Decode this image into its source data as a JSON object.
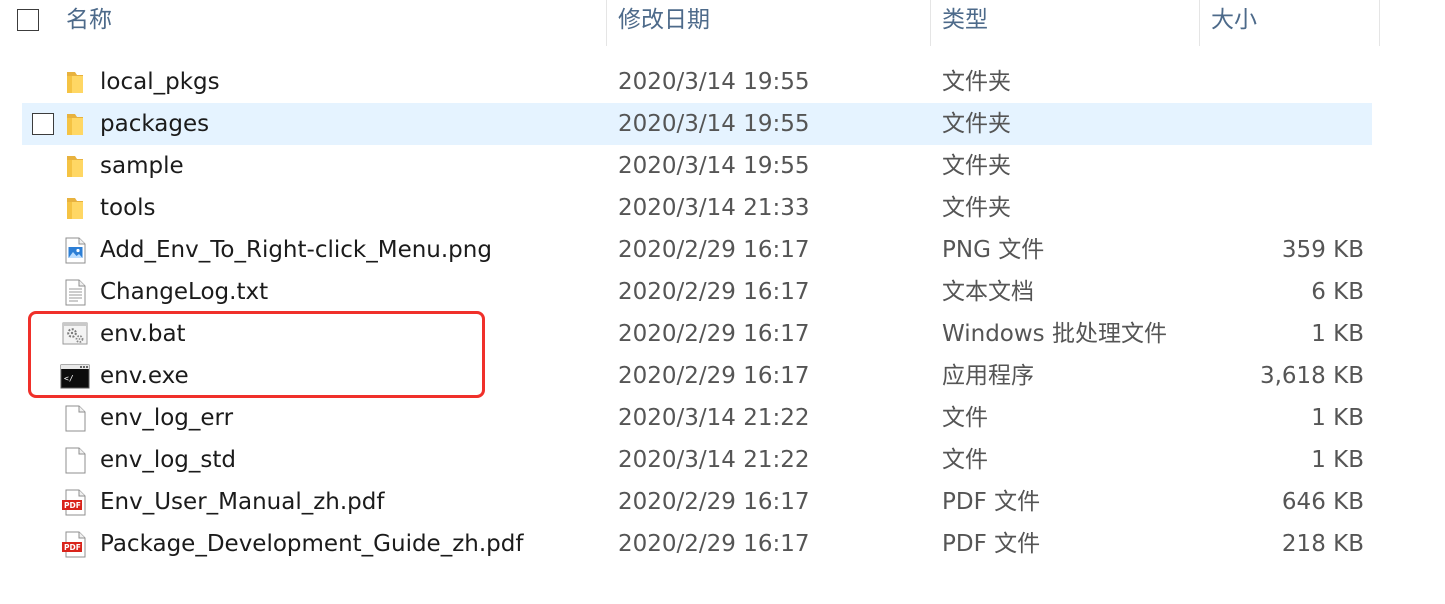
{
  "header": {
    "col_name": "名称",
    "col_date": "修改日期",
    "col_type": "类型",
    "col_size": "大小"
  },
  "files": [
    {
      "name": "local_pkgs",
      "date": "2020/3/14 19:55",
      "type": "文件夹",
      "size": "",
      "icon": "folder-icon"
    },
    {
      "name": "packages",
      "date": "2020/3/14 19:55",
      "type": "文件夹",
      "size": "",
      "icon": "folder-icon"
    },
    {
      "name": "sample",
      "date": "2020/3/14 19:55",
      "type": "文件夹",
      "size": "",
      "icon": "folder-icon"
    },
    {
      "name": "tools",
      "date": "2020/3/14 21:33",
      "type": "文件夹",
      "size": "",
      "icon": "folder-icon"
    },
    {
      "name": "Add_Env_To_Right-click_Menu.png",
      "date": "2020/2/29 16:17",
      "type": "PNG 文件",
      "size": "359 KB",
      "icon": "image-file-icon"
    },
    {
      "name": "ChangeLog.txt",
      "date": "2020/2/29 16:17",
      "type": "文本文档",
      "size": "6 KB",
      "icon": "text-file-icon"
    },
    {
      "name": "env.bat",
      "date": "2020/2/29 16:17",
      "type": "Windows 批处理文件",
      "size": "1 KB",
      "icon": "batch-file-icon"
    },
    {
      "name": "env.exe",
      "date": "2020/2/29 16:17",
      "type": "应用程序",
      "size": "3,618 KB",
      "icon": "console-app-icon"
    },
    {
      "name": "env_log_err",
      "date": "2020/3/14 21:22",
      "type": "文件",
      "size": "1 KB",
      "icon": "blank-file-icon"
    },
    {
      "name": "env_log_std",
      "date": "2020/3/14 21:22",
      "type": "文件",
      "size": "1 KB",
      "icon": "blank-file-icon"
    },
    {
      "name": "Env_User_Manual_zh.pdf",
      "date": "2020/2/29 16:17",
      "type": "PDF 文件",
      "size": "646 KB",
      "icon": "pdf-file-icon"
    },
    {
      "name": "Package_Development_Guide_zh.pdf",
      "date": "2020/2/29 16:17",
      "type": "PDF 文件",
      "size": "218 KB",
      "icon": "pdf-file-icon"
    }
  ],
  "colors": {
    "selection": "#e5f3ff",
    "header_text": "#4d6a8a",
    "highlight_border": "#f0302a"
  }
}
